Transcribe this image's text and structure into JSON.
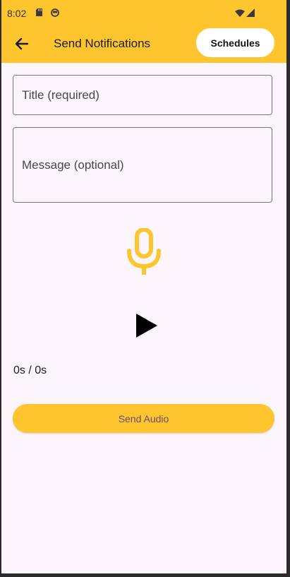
{
  "status_bar": {
    "time": "8:02",
    "icons": [
      "sd-card-icon",
      "circle-face-icon",
      "wifi-icon",
      "signal-icon"
    ]
  },
  "app_bar": {
    "back_icon": "arrow-left-icon",
    "title": "Send Notifications",
    "schedules_label": "Schedules"
  },
  "form": {
    "title_placeholder": "Title (required)",
    "message_placeholder": "Message (optional)"
  },
  "audio": {
    "mic_icon": "microphone-icon",
    "play_icon": "play-icon",
    "progress": "0s / 0s",
    "send_label": "Send Audio"
  },
  "colors": {
    "accent": "#fec52e",
    "background": "#fcf5fc",
    "mic": "#fec52e",
    "send_text": "#6a4f6f"
  }
}
